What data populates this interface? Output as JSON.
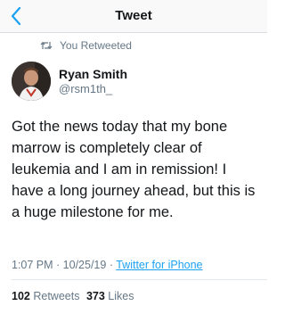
{
  "navbar": {
    "title": "Tweet",
    "back_icon": "chevron-left-icon"
  },
  "retweet_context": {
    "icon": "retweet-icon",
    "label": "You Retweeted"
  },
  "tweet": {
    "author_name": "Ryan Smith",
    "author_handle": "@rsm1th_",
    "text": "Got the news today that my bone marrow is completely clear of leukemia and I am in remission! I have a long journey ahead, but this is a huge milestone for me.",
    "time": "1:07 PM",
    "separator": " · ",
    "date": "10/25/19",
    "client": "Twitter for iPhone",
    "retweets_count": "102",
    "retweets_label": "Retweets",
    "likes_count": "373",
    "likes_label": "Likes"
  },
  "colors": {
    "accent": "#1da1f2",
    "secondary_text": "#657786",
    "primary_text": "#14171a"
  }
}
